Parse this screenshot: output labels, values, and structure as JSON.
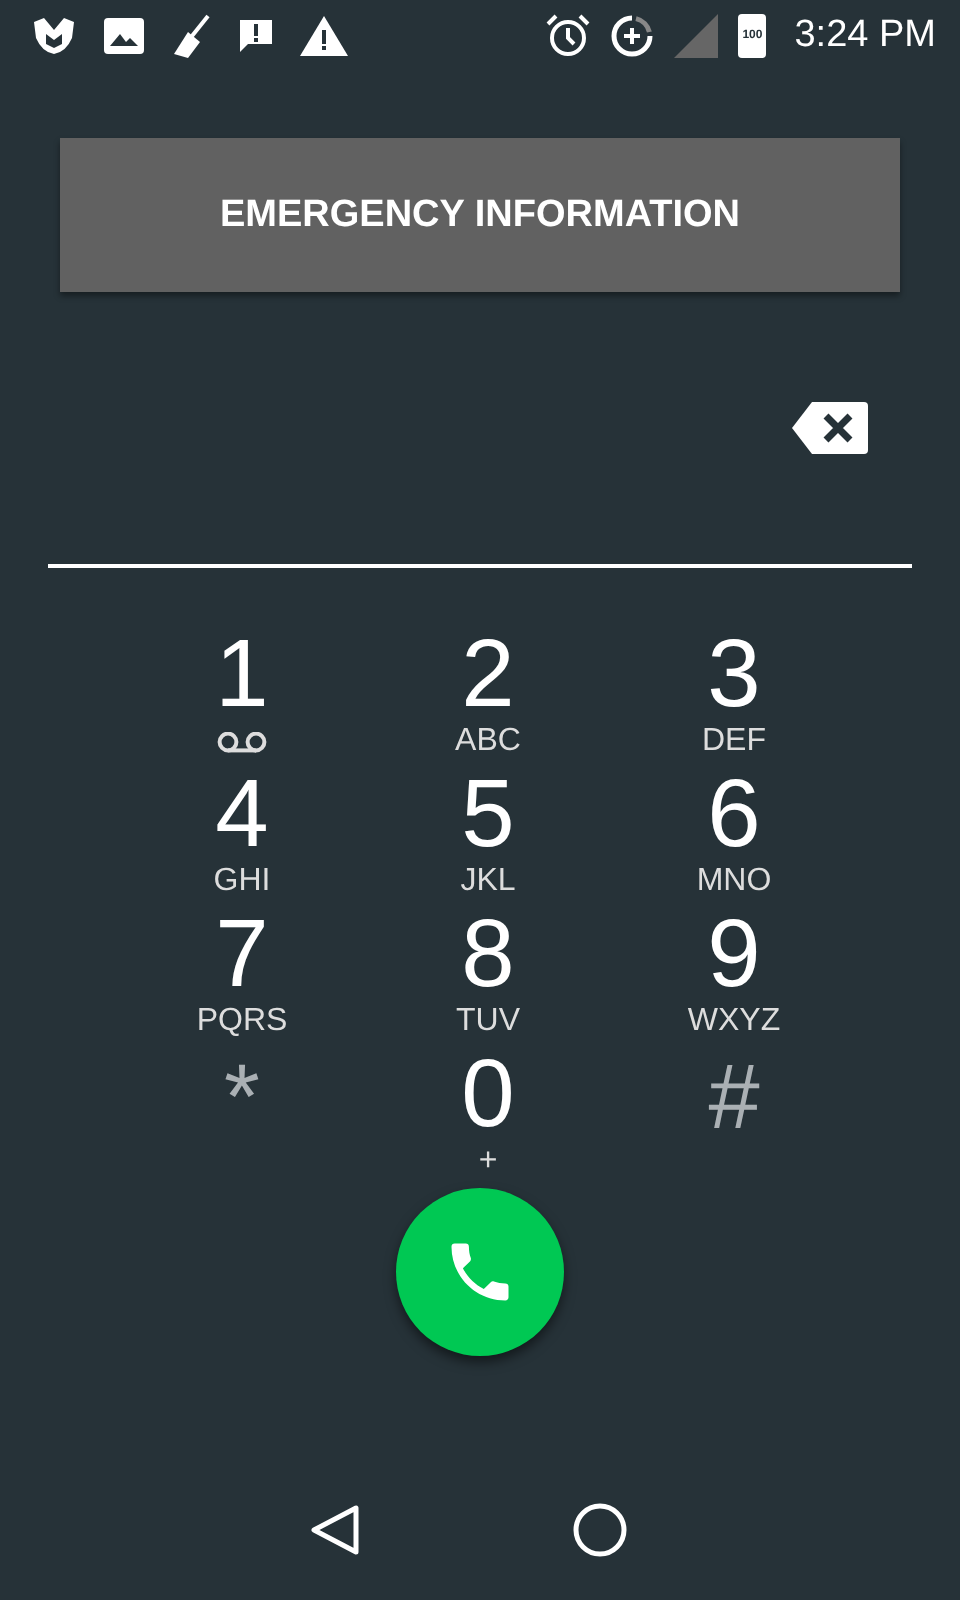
{
  "status_bar": {
    "time": "3:24 PM",
    "battery": "100"
  },
  "emergency_button": {
    "label": "EMERGENCY INFORMATION"
  },
  "keys": [
    {
      "kind": "voicemail",
      "digit": "1"
    },
    {
      "kind": "letters",
      "digit": "2",
      "letters": "ABC"
    },
    {
      "kind": "letters",
      "digit": "3",
      "letters": "DEF"
    },
    {
      "kind": "letters",
      "digit": "4",
      "letters": "GHI"
    },
    {
      "kind": "letters",
      "digit": "5",
      "letters": "JKL"
    },
    {
      "kind": "letters",
      "digit": "6",
      "letters": "MNO"
    },
    {
      "kind": "letters",
      "digit": "7",
      "letters": "PQRS"
    },
    {
      "kind": "letters",
      "digit": "8",
      "letters": "TUV"
    },
    {
      "kind": "letters",
      "digit": "9",
      "letters": "WXYZ"
    },
    {
      "kind": "symbol",
      "digit": "*"
    },
    {
      "kind": "letters",
      "digit": "0",
      "letters": "+"
    },
    {
      "kind": "symbol",
      "digit": "#"
    }
  ]
}
